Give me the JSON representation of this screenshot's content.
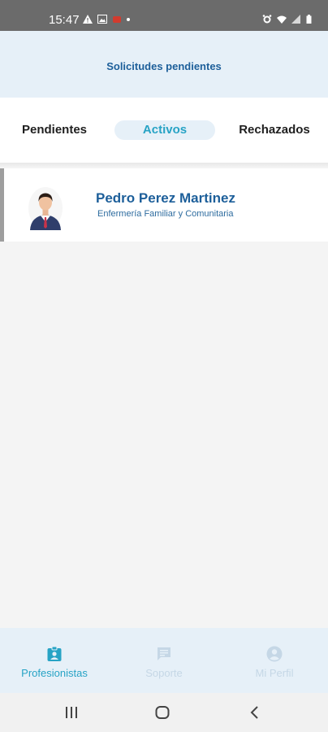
{
  "status_bar": {
    "time": "15:47",
    "left_icons": [
      "alert-triangle-icon",
      "image-icon",
      "red-app-icon",
      "dot-icon"
    ],
    "right_icons": [
      "alarm-icon",
      "wifi-icon",
      "signal-icon",
      "battery-icon"
    ]
  },
  "header": {
    "title": "Solicitudes pendientes"
  },
  "tabs": [
    {
      "label": "Pendientes",
      "active": false
    },
    {
      "label": "Activos",
      "active": true
    },
    {
      "label": "Rechazados",
      "active": false
    }
  ],
  "list": [
    {
      "name": "Pedro Perez Martinez",
      "specialty": "Enfermería Familiar y Comunitaria",
      "avatar_icon": "doctor-avatar-icon"
    }
  ],
  "bottom_nav": [
    {
      "label": "Profesionistas",
      "icon": "id-badge-icon",
      "active": true
    },
    {
      "label": "Soporte",
      "icon": "chat-icon",
      "active": false
    },
    {
      "label": "Mi Perfil",
      "icon": "profile-icon",
      "active": false
    }
  ],
  "system_nav": [
    "recents-icon",
    "home-icon",
    "back-icon"
  ],
  "colors": {
    "accent": "#27a3c5",
    "brand_blue": "#1d5f9a",
    "header_bg": "#e6f0f8",
    "status_bar_bg": "#6b6b6b"
  }
}
